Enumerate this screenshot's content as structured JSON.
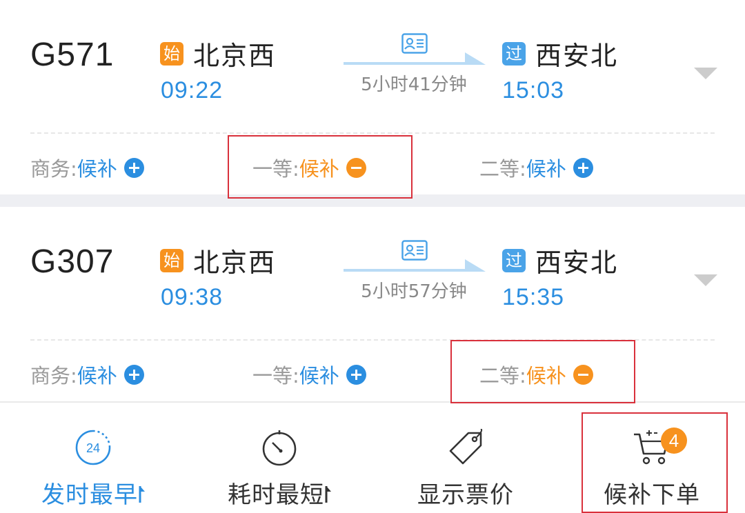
{
  "trains": [
    {
      "number": "G571",
      "from_tag": "始",
      "from": "北京西",
      "dep_time": "09:22",
      "duration": "5小时41分钟",
      "to_tag": "过",
      "to": "西安北",
      "arr_time": "15:03",
      "seats": [
        {
          "class": "商务:",
          "status": "候补",
          "state": "add"
        },
        {
          "class": "一等:",
          "status": "候补",
          "state": "selected"
        },
        {
          "class": "二等:",
          "status": "候补",
          "state": "add"
        }
      ]
    },
    {
      "number": "G307",
      "from_tag": "始",
      "from": "北京西",
      "dep_time": "09:38",
      "duration": "5小时57分钟",
      "to_tag": "过",
      "to": "西安北",
      "arr_time": "15:35",
      "seats": [
        {
          "class": "商务:",
          "status": "候补",
          "state": "add"
        },
        {
          "class": "一等:",
          "status": "候补",
          "state": "add"
        },
        {
          "class": "二等:",
          "status": "候补",
          "state": "selected"
        }
      ]
    }
  ],
  "toolbar": {
    "earliest_departure": "发时最早",
    "earliest_icon_text": "24",
    "shortest_duration": "耗时最短",
    "show_price": "显示票价",
    "waitlist_order": "候补下单",
    "cart_badge": "4"
  },
  "colors": {
    "accent_blue": "#2b8ee0",
    "accent_orange": "#f7921e",
    "highlight_red": "#d9303b"
  }
}
